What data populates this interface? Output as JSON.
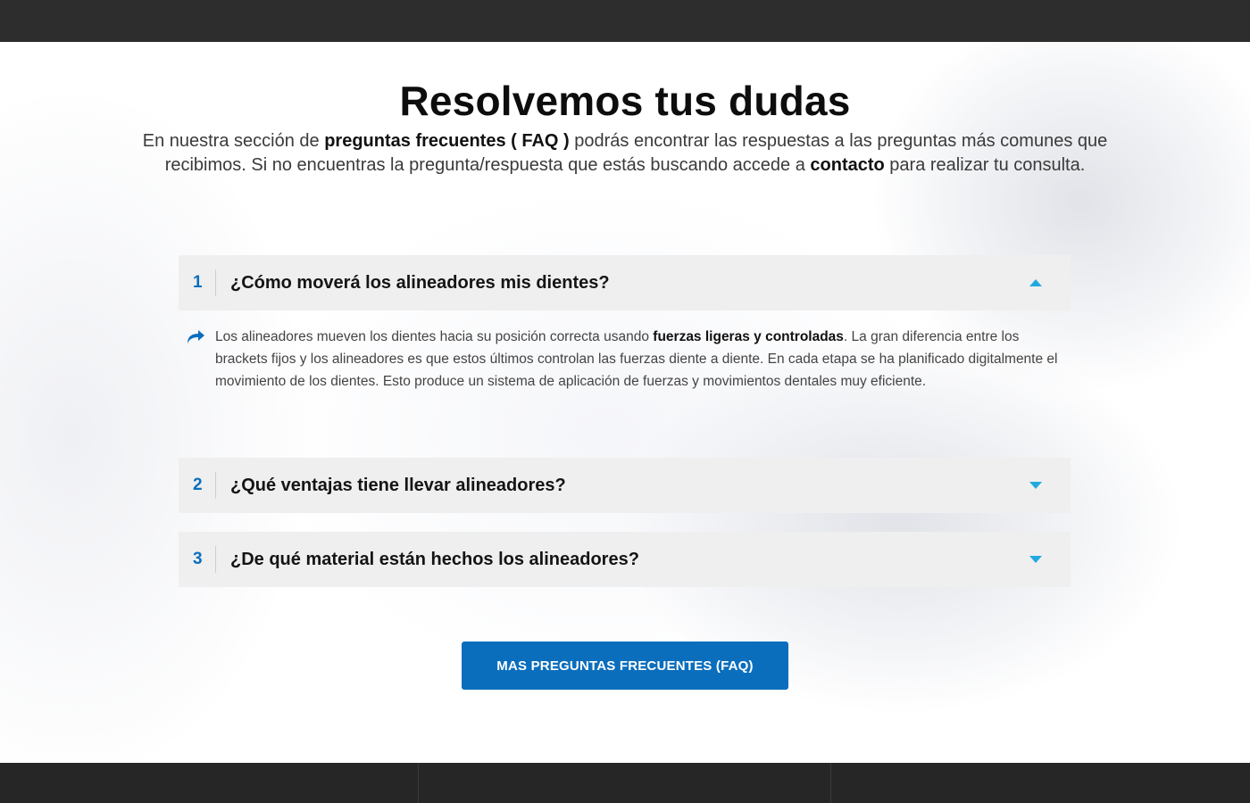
{
  "section": {
    "title": "Resolvemos tus dudas",
    "intro": {
      "p1": "En nuestra sección de ",
      "b1": "preguntas frecuentes ( FAQ )",
      "p2": " podrás encontrar las respuestas a las preguntas más comunes que recibimos. Si no encuentras la pregunta/respuesta que estás buscando accede a ",
      "b2": "contacto",
      "p3": " para realizar tu consulta."
    }
  },
  "faq": [
    {
      "number": "1",
      "question": "¿Cómo moverá los alineadores mis dientes?",
      "expanded": true,
      "answer": {
        "p1": "Los alineadores mueven los dientes hacia su posición correcta usando ",
        "b1": "fuerzas ligeras y controladas",
        "p2": ". La gran diferencia entre los brackets fijos y los alineadores es que estos últimos controlan las fuerzas diente a diente. En cada etapa se ha planificado digitalmente el movimiento de los dientes. Esto produce un sistema de aplicación de fuerzas y movimientos dentales muy eficiente."
      }
    },
    {
      "number": "2",
      "question": "¿Qué ventajas tiene llevar alineadores?",
      "expanded": false
    },
    {
      "number": "3",
      "question": "¿De qué material están hechos los alineadores?",
      "expanded": false
    }
  ],
  "cta": {
    "label": "MAS PREGUNTAS FRECUENTES (FAQ)"
  },
  "colors": {
    "accent": "#0a6ebd",
    "caret": "#21a8e0",
    "header_bg": "#2d2d2d",
    "footer_bg": "#262626",
    "item_bg": "#efefef"
  },
  "icons": {
    "expanded": "caret-up-icon",
    "collapsed": "caret-down-icon",
    "answer": "share-arrow-icon"
  }
}
